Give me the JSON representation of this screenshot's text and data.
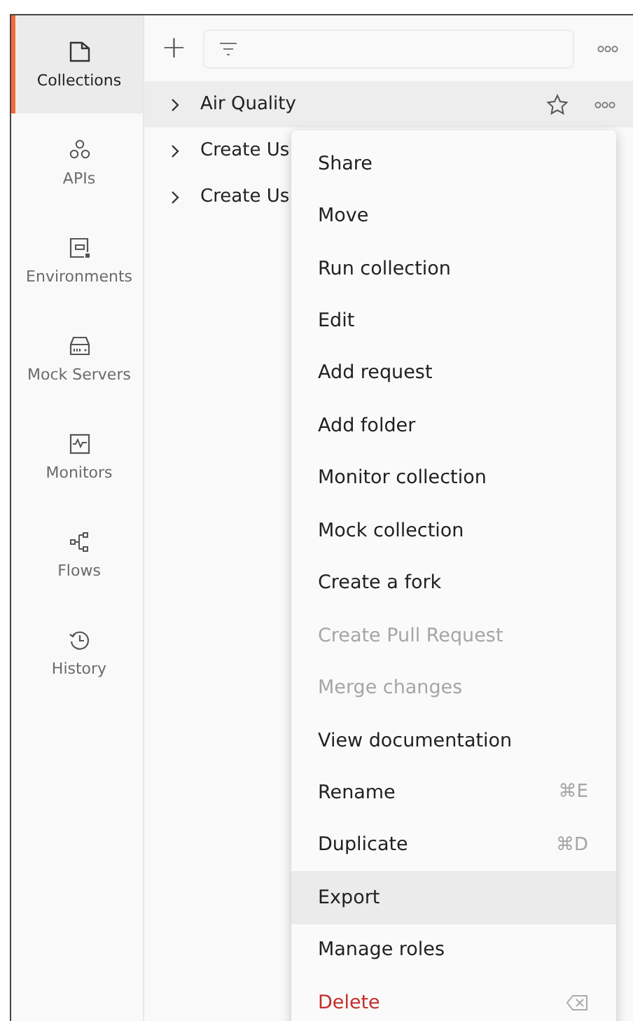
{
  "sidebar": {
    "items": [
      {
        "label": "Collections",
        "selected": true
      },
      {
        "label": "APIs",
        "selected": false
      },
      {
        "label": "Environments",
        "selected": false
      },
      {
        "label": "Mock Servers",
        "selected": false
      },
      {
        "label": "Monitors",
        "selected": false
      },
      {
        "label": "Flows",
        "selected": false
      },
      {
        "label": "History",
        "selected": false
      }
    ]
  },
  "toolbar": {
    "add": "+"
  },
  "collections": [
    {
      "name": "Air Quality",
      "selected": true
    },
    {
      "name": "Create Us",
      "selected": false
    },
    {
      "name": "Create Us",
      "selected": false
    }
  ],
  "context_menu": {
    "items": [
      {
        "label": "Share",
        "kind": "normal",
        "selected": false
      },
      {
        "label": "Move",
        "kind": "normal",
        "selected": false
      },
      {
        "label": "Run collection",
        "kind": "normal",
        "selected": false
      },
      {
        "label": "Edit",
        "kind": "normal",
        "selected": false
      },
      {
        "label": "Add request",
        "kind": "normal",
        "selected": false
      },
      {
        "label": "Add folder",
        "kind": "normal",
        "selected": false
      },
      {
        "label": "Monitor collection",
        "kind": "normal",
        "selected": false
      },
      {
        "label": "Mock collection",
        "kind": "normal",
        "selected": false
      },
      {
        "label": "Create a fork",
        "kind": "normal",
        "selected": false
      },
      {
        "label": "Create Pull Request",
        "kind": "disabled",
        "selected": false
      },
      {
        "label": "Merge changes",
        "kind": "disabled",
        "selected": false
      },
      {
        "label": "View documentation",
        "kind": "normal",
        "selected": false
      },
      {
        "label": "Rename",
        "kind": "normal",
        "selected": false,
        "shortcut": "⌘E"
      },
      {
        "label": "Duplicate",
        "kind": "normal",
        "selected": false,
        "shortcut": "⌘D"
      },
      {
        "label": "Export",
        "kind": "normal",
        "selected": true
      },
      {
        "label": "Manage roles",
        "kind": "normal",
        "selected": false
      },
      {
        "label": "Delete",
        "kind": "danger",
        "selected": false
      }
    ]
  }
}
